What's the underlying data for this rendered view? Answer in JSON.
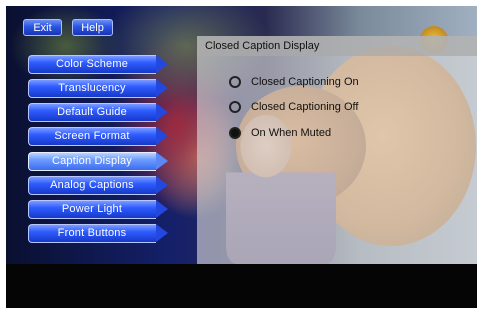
{
  "top_buttons": {
    "exit_label": "Exit",
    "help_label": "Help"
  },
  "menu": {
    "items": [
      {
        "label": "Color Scheme"
      },
      {
        "label": "Translucency"
      },
      {
        "label": "Default Guide"
      },
      {
        "label": "Screen Format"
      },
      {
        "label": "Caption Display",
        "selected": true
      },
      {
        "label": "Analog Captions"
      },
      {
        "label": "Power Light"
      },
      {
        "label": "Front Buttons"
      }
    ]
  },
  "panel": {
    "title": "Closed Caption Display",
    "options": [
      {
        "label": "Closed Captioning On",
        "checked": false
      },
      {
        "label": "Closed Captioning Off",
        "checked": false
      },
      {
        "label": "On When Muted",
        "checked": true
      }
    ]
  },
  "colors": {
    "menu_blue": "#2e5cff",
    "menu_selected": "#6c9cff",
    "panel_bg": "#dcdcdc",
    "screen_bg": "#050505"
  }
}
